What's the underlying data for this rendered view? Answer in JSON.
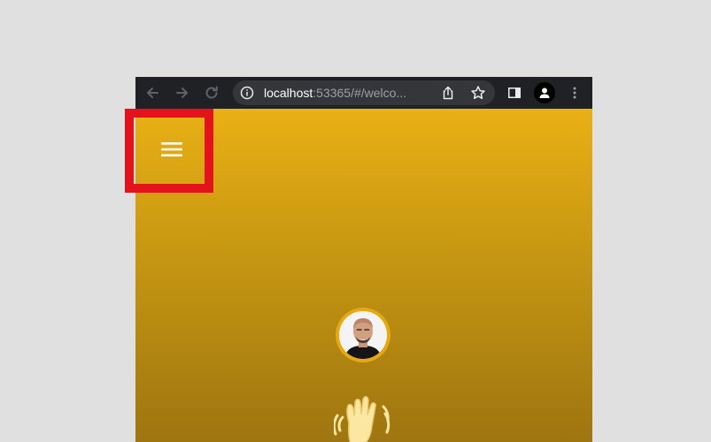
{
  "browser": {
    "url_host": "localhost",
    "url_rest": ":53365/#/welco...",
    "icons": {
      "back": "arrow-left-icon",
      "forward": "arrow-right-icon",
      "reload": "reload-icon",
      "info": "info-icon",
      "share": "share-icon",
      "bookmark": "star-icon",
      "side_panel": "side-panel-icon",
      "profile": "user-icon",
      "menu": "kebab-menu-icon"
    },
    "colors": {
      "chrome": "#202124",
      "omnibox": "#35363a"
    }
  },
  "page": {
    "menu_icon": "hamburger-menu-icon",
    "avatar_icon": "profile-photo",
    "greeting_icon": "waving-hand-icon",
    "colors": {
      "gradient_top": "#eab015",
      "gradient_bottom": "#9e7510",
      "highlight": "#e3121b",
      "avatar_ring": "#e7a812"
    }
  }
}
